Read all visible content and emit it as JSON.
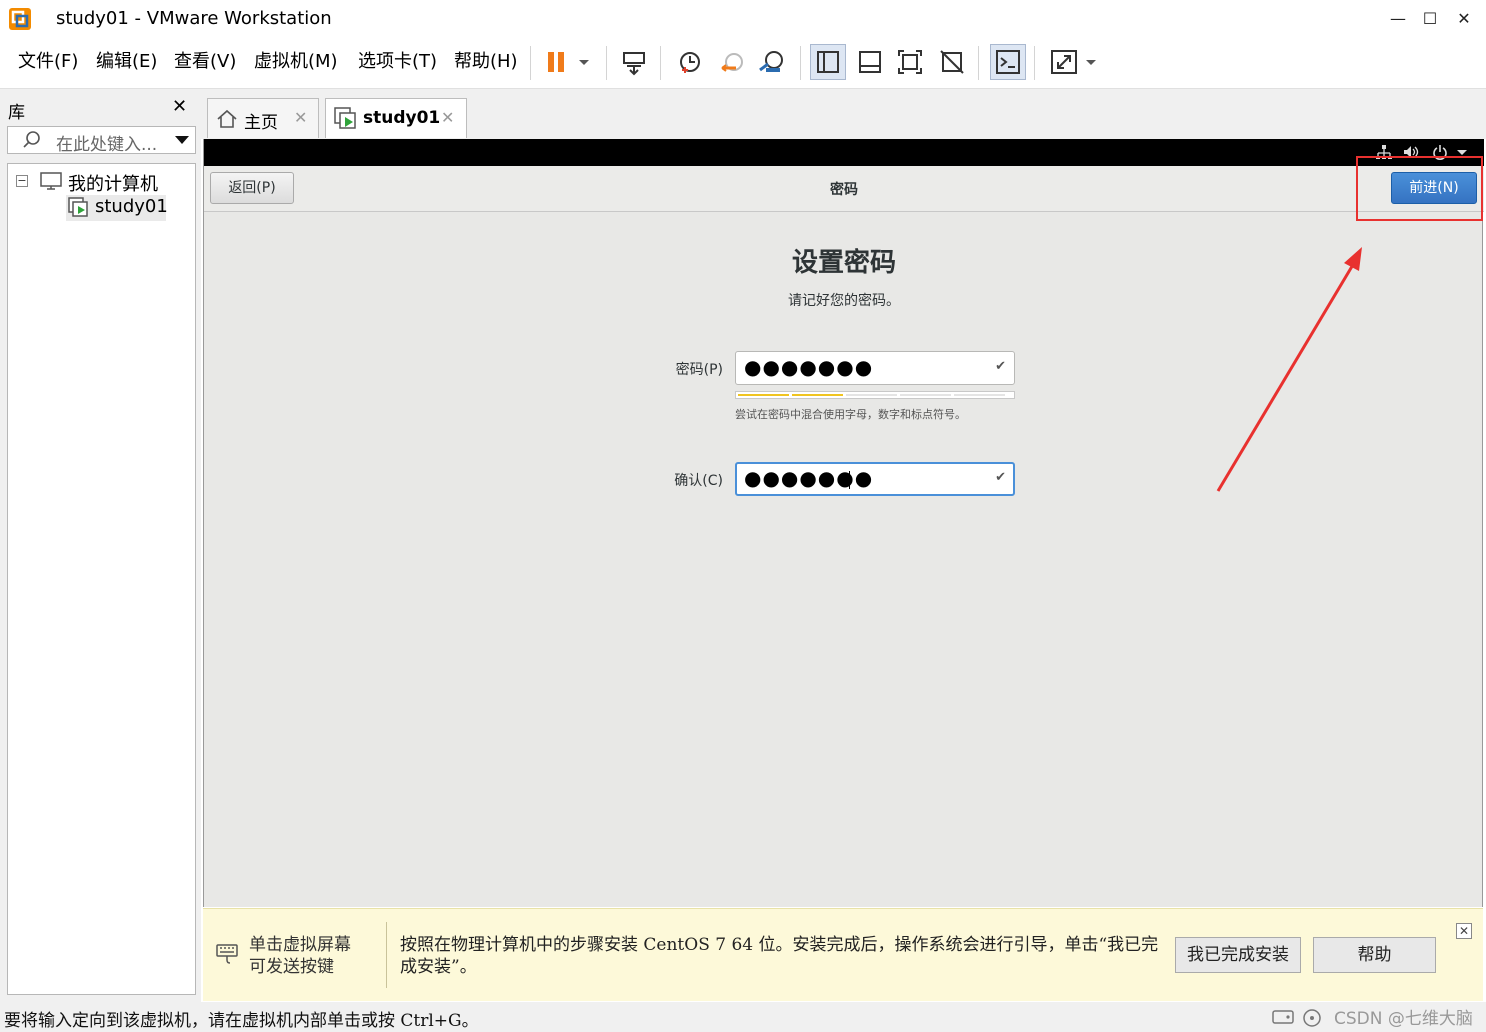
{
  "window": {
    "title": "study01 - VMware Workstation",
    "minimize": "—",
    "maximize": "☐",
    "close": "✕"
  },
  "menubar": {
    "items": [
      {
        "label": "文件(F)"
      },
      {
        "label": "编辑(E)"
      },
      {
        "label": "查看(V)"
      },
      {
        "label": "虚拟机(M)"
      },
      {
        "label": "选项卡(T)"
      },
      {
        "label": "帮助(H)"
      }
    ]
  },
  "library": {
    "title": "库",
    "close": "✕",
    "search_placeholder": "在此处键入...",
    "tree": {
      "root": "我的计算机",
      "child": "study01",
      "expander": "−"
    }
  },
  "tabs": [
    {
      "label": "主页",
      "close": "✕"
    },
    {
      "label": "study01",
      "close": "✕"
    }
  ],
  "vm": {
    "back_label": "返回(P)",
    "header_title": "密码",
    "next_label": "前进(N)",
    "setup_title": "设置密码",
    "setup_subtitle": "请记好您的密码。",
    "password_label": "密码(P)",
    "password_value": "●●●●●●●",
    "confirm_label": "确认(C)",
    "confirm_value": "●●●●●●●",
    "check": "✔",
    "strength_level": 0.4,
    "strength_color": "#f0c420",
    "hint": "尝试在密码中混合使用字母，数字和标点符号。"
  },
  "notification": {
    "left_line1": "单击虚拟屏幕",
    "left_line2": "可发送按键",
    "message": "按照在物理计算机中的步骤安装 CentOS 7 64 位。安装完成后，操作系统会进行引导，单击“我已完成安装”。",
    "done_button": "我已完成安装",
    "help_button": "帮助",
    "close": "✕"
  },
  "statusbar": {
    "text": "要将输入定向到该虚拟机，请在虚拟机内部单击或按 Ctrl+G。",
    "watermark": "CSDN @七维大脑"
  },
  "colors": {
    "accent": "#4a90d9",
    "annotation_red": "#e8312f",
    "pause_orange": "#f07b1a"
  }
}
